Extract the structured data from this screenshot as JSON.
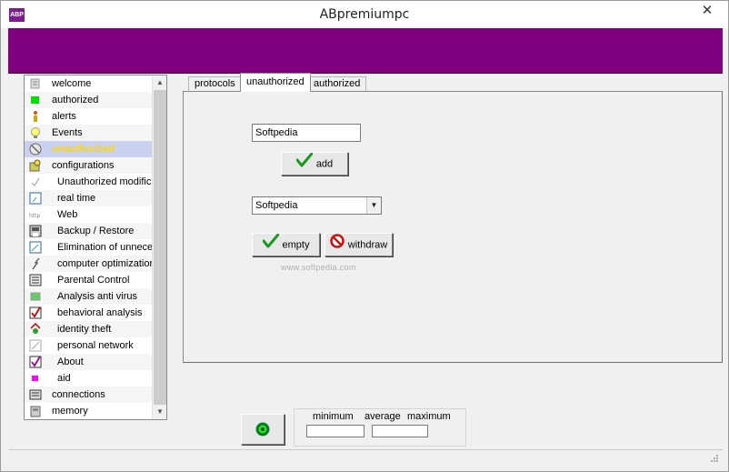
{
  "window": {
    "title": "ABpremiumpc",
    "app_icon_text": "ABP",
    "close_glyph": "✕",
    "banner_color": "#800080"
  },
  "sidebar": {
    "items": [
      {
        "label": "welcome",
        "icon": "page-icon",
        "child": false
      },
      {
        "label": "authorized",
        "icon": "green-square-icon",
        "child": false
      },
      {
        "label": "alerts",
        "icon": "alert-person-icon",
        "child": false
      },
      {
        "label": "Events",
        "icon": "lightbulb-icon",
        "child": false
      },
      {
        "label": "unauthorized",
        "icon": "blocked-icon",
        "child": false,
        "selected": true
      },
      {
        "label": "configurations",
        "icon": "config-icon",
        "child": false
      },
      {
        "label": "Unauthorized modifications",
        "icon": "check-icon",
        "child": true
      },
      {
        "label": "real time",
        "icon": "clock-icon",
        "child": true
      },
      {
        "label": "Web",
        "icon": "http-icon",
        "child": true
      },
      {
        "label": "Backup / Restore",
        "icon": "backup-icon",
        "child": true
      },
      {
        "label": "Elimination of unnecessary",
        "icon": "cleanup-icon",
        "child": true
      },
      {
        "label": "computer optimization",
        "icon": "optimize-icon",
        "child": true
      },
      {
        "label": "Parental Control",
        "icon": "list-icon",
        "child": true
      },
      {
        "label": "Analysis anti virus",
        "icon": "antivirus-icon",
        "child": true
      },
      {
        "label": "behavioral analysis",
        "icon": "red-check-icon",
        "child": true
      },
      {
        "label": "identity theft",
        "icon": "identity-icon",
        "child": true
      },
      {
        "label": "personal network",
        "icon": "network-icon",
        "child": true
      },
      {
        "label": "About",
        "icon": "about-check-icon",
        "child": true
      },
      {
        "label": "aid",
        "icon": "magenta-square-icon",
        "child": true
      },
      {
        "label": "connections",
        "icon": "connections-icon",
        "child": false
      },
      {
        "label": "memory",
        "icon": "memory-icon",
        "child": false
      }
    ]
  },
  "tabs": [
    {
      "label": "protocols"
    },
    {
      "label": "unauthorized",
      "active": true
    },
    {
      "label": "authorized"
    }
  ],
  "panel": {
    "text_input_value": "Softpedia",
    "add_label": "add",
    "combo_value": "Softpedia",
    "empty_label": "empty",
    "withdraw_label": "withdraw",
    "watermark": "www.softpedia.com"
  },
  "metrics": {
    "minimum_label": "minimum",
    "average_label": "average",
    "maximum_label": "maximum",
    "minimum_value": "",
    "average_value": ""
  },
  "colors": {
    "accent": "#800080",
    "selected_row": "#c9d0f2",
    "selected_text": "#ffd700"
  }
}
